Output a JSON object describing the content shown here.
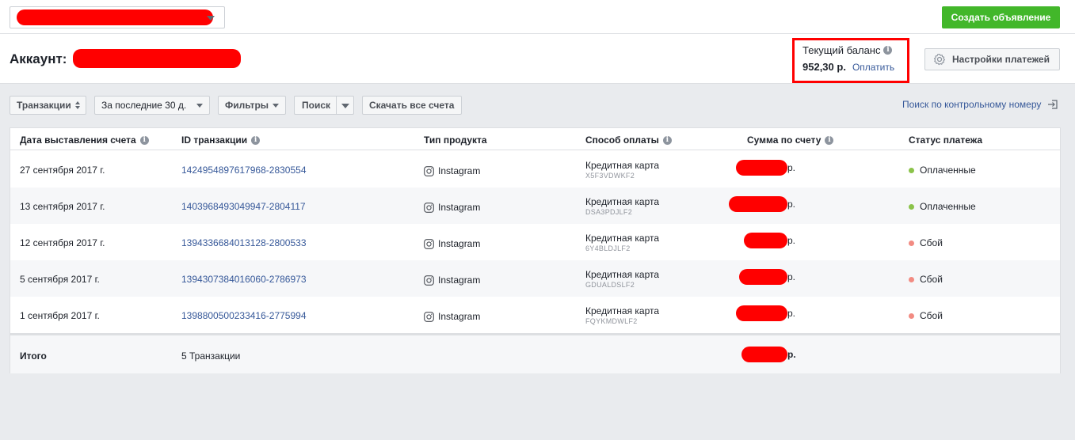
{
  "topbar": {
    "create_ad_label": "Создать объявление"
  },
  "header": {
    "account_label": "Аккаунт:",
    "balance_title": "Текущий баланс",
    "balance_amount": "952,30 р.",
    "pay_label": "Оплатить",
    "payment_settings_label": "Настройки платежей"
  },
  "filters": {
    "transactions_label": "Транзакции",
    "period_label": "За последние 30 д.",
    "filters_label": "Фильтры",
    "search_label": "Поиск",
    "download_all_label": "Скачать все счета",
    "contract_search_label": "Поиск по контрольному номеру"
  },
  "table": {
    "columns": [
      "Дата выставления счета",
      "ID транзакции",
      "Тип продукта",
      "Способ оплаты",
      "Сумма по счету",
      "Статус платежа"
    ],
    "rows": [
      {
        "date": "27 сентября 2017 г.",
        "id": "1424954897617968-2830554",
        "product": "Instagram",
        "method": "Кредитная карта",
        "method_code": "X5F3VDWKF2",
        "currency": "р.",
        "status": "Оплаченные"
      },
      {
        "date": "13 сентября 2017 г.",
        "id": "1403968493049947-2804117",
        "product": "Instagram",
        "method": "Кредитная карта",
        "method_code": "DSA3PDJLF2",
        "currency": "р.",
        "status": "Оплаченные"
      },
      {
        "date": "12 сентября 2017 г.",
        "id": "1394336684013128-2800533",
        "product": "Instagram",
        "method": "Кредитная карта",
        "method_code": "6Y4BLDJLF2",
        "currency": "р.",
        "status": "Сбой"
      },
      {
        "date": "5 сентября 2017 г.",
        "id": "1394307384016060-2786973",
        "product": "Instagram",
        "method": "Кредитная карта",
        "method_code": "GDUALDSLF2",
        "currency": "р.",
        "status": "Сбой"
      },
      {
        "date": "1 сентября 2017 г.",
        "id": "1398800500233416-2775994",
        "product": "Instagram",
        "method": "Кредитная карта",
        "method_code": "FQYKMDWLF2",
        "currency": "р.",
        "status": "Сбой"
      }
    ],
    "total_label": "Итого",
    "total_count": "5 Транзакции",
    "total_currency": "р."
  },
  "colors": {
    "paid": "#8bc34a",
    "failed": "#f28b82",
    "accent_green": "#42b72a",
    "link": "#365899",
    "redaction": "#ff0000"
  },
  "icons": [
    "chevron-down-icon",
    "info-icon",
    "gear-icon",
    "sort-icon",
    "exit-icon",
    "instagram-icon",
    "status-dot-icon"
  ]
}
